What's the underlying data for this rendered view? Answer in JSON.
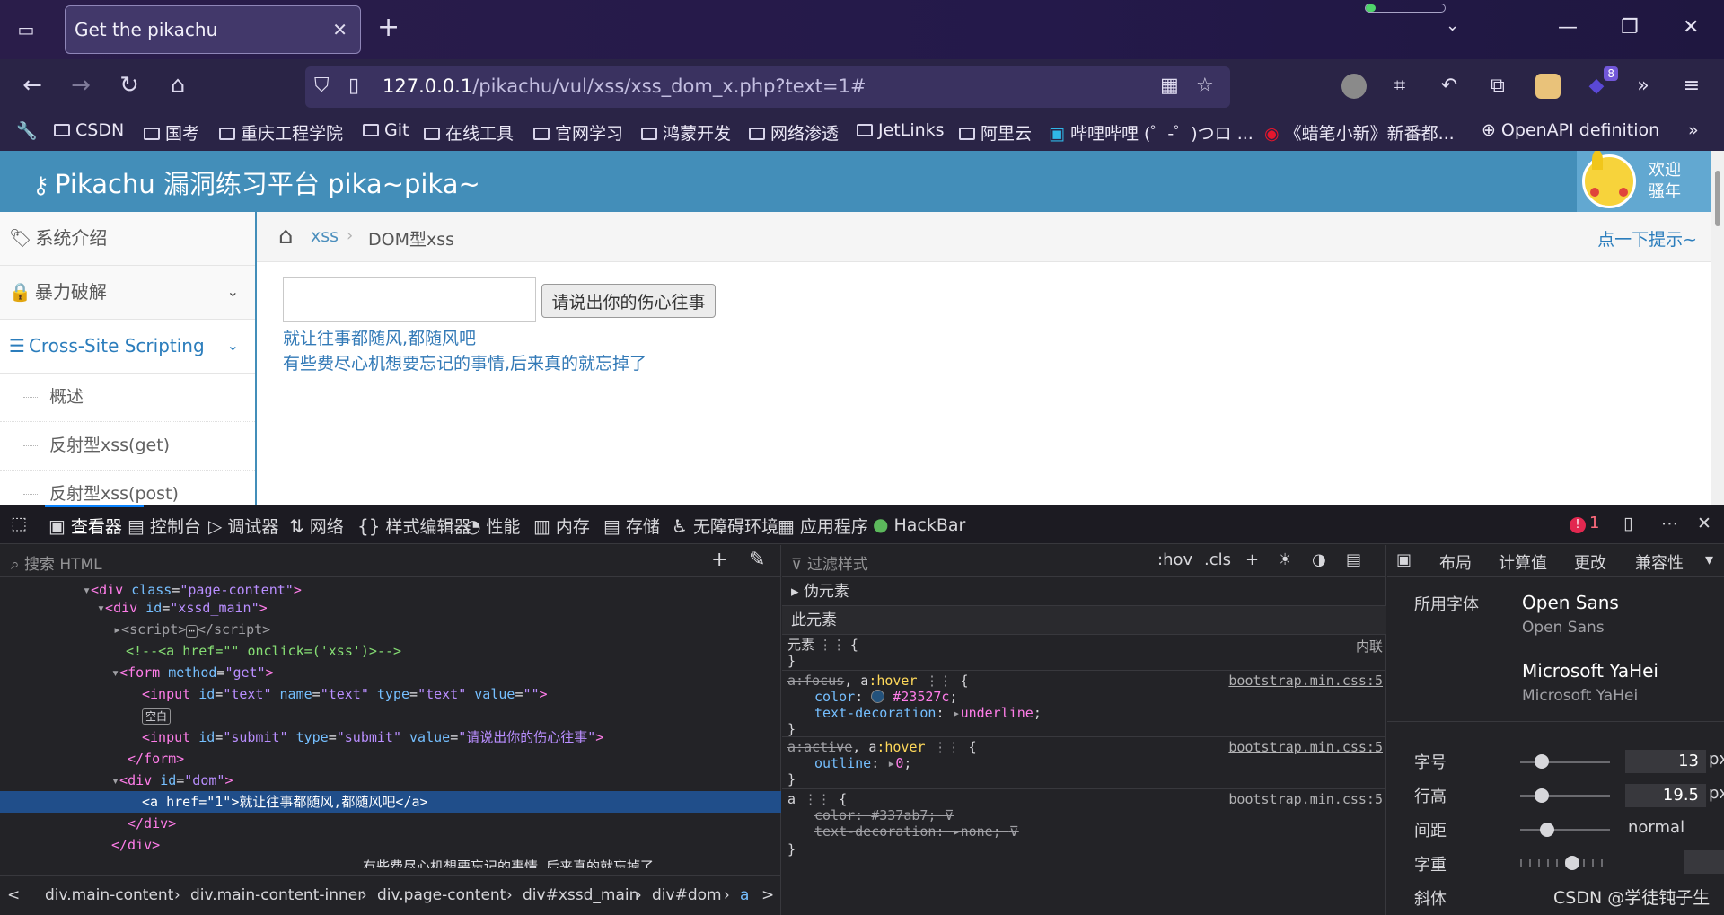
{
  "browser": {
    "tab_title": "Get the pikachu",
    "url_host": "127.0.0.1",
    "url_path": "/pikachu/vul/xss/xss_dom_x.php?text=1#",
    "ext_badge_count": "8",
    "load_progress": 0.12
  },
  "bookmarks": [
    "CSDN",
    "国考",
    "重庆工程学院",
    "Git",
    "在线工具",
    "官网学习",
    "鸿蒙开发",
    "网络渗透",
    "JetLinks",
    "阿里云",
    "哔哩哔哩 (゜-゜)つロ ...",
    "《蜡笔小新》新番都...",
    "OpenAPI definition"
  ],
  "site": {
    "title": "Pikachu 漏洞练习平台 pika~pika~",
    "welcome": "欢迎",
    "username": "骚年"
  },
  "sidebar": {
    "items": [
      "系统介绍",
      "暴力破解",
      "Cross-Site Scripting"
    ],
    "subitems": [
      "概述",
      "反射型xss(get)",
      "反射型xss(post)"
    ]
  },
  "breadcrumb": {
    "section": "xss",
    "current": "DOM型xss",
    "hint": "点一下提示~"
  },
  "main": {
    "input_value": "",
    "submit_label": "请说出你的伤心往事",
    "dom_link": "就让往事都随风,都随风吧",
    "message": "有些费尽心机想要忘记的事情,后来真的就忘掉了"
  },
  "devtools": {
    "tabs": [
      "查看器",
      "控制台",
      "调试器",
      "网络",
      "样式编辑器",
      "性能",
      "内存",
      "存储",
      "无障碍环境",
      "应用程序",
      "HackBar"
    ],
    "error_count": "1",
    "search_placeholder": "搜索 HTML",
    "filter_placeholder": "过滤样式",
    "filter_actions": [
      ":hov",
      ".cls"
    ],
    "breadcrumbs": [
      "div.main-content",
      "div.main-content-inner",
      "div.page-content",
      "div#xssd_main",
      "div#dom",
      "a"
    ],
    "empty_badge": "空白",
    "tree": {
      "l1_tag": "div",
      "l1_attr": "class",
      "l1_val": "\"page-content\"",
      "l2_tag": "div",
      "l2_attr": "id",
      "l2_val": "\"xssd_main\"",
      "l3_tag": "script",
      "l4_comment": "<!--<a href=\"\" onclick=('xss')>-->",
      "l5_tag": "form",
      "l5_attr": "method",
      "l5_val": "\"get\"",
      "l6_tag": "input",
      "l6_a1": "id",
      "l6_v1": "\"text\"",
      "l6_a2": "name",
      "l6_v2": "\"text\"",
      "l6_a3": "type",
      "l6_v3": "\"text\"",
      "l6_a4": "value",
      "l6_v4": "\"\"",
      "l8_tag": "input",
      "l8_a1": "id",
      "l8_v1": "\"submit\"",
      "l8_a2": "type",
      "l8_v2": "\"submit\"",
      "l8_a3": "value",
      "l8_v3": "\"请说出你的伤心往事\"",
      "l9_close": "</form>",
      "l10_tag": "div",
      "l10_attr": "id",
      "l10_val": "\"dom\"",
      "l11_tag": "a",
      "l11_attr": "href",
      "l11_val": "\"1\"",
      "l11_text": "就让往事都随风,都随风吧",
      "l12_close": "</div>",
      "l13_close": "</div>",
      "l14_overflow": "有些费尽心机想要忘记的事情,后来真的就忘掉了"
    },
    "styles": {
      "pseudo": "伪元素",
      "this_element": "此元素",
      "element_selector": "元素",
      "inline": "内联",
      "rule1_sel_a": "a:focus",
      "rule1_sel_b": "a:hover",
      "rule1_src": "bootstrap.min.css:5",
      "rule1_p1": "color",
      "rule1_v1": "#23527c",
      "rule1_p2": "text-decoration",
      "rule1_v2": "underline",
      "rule2_sel_a": "a:active",
      "rule2_sel_b": "a:hover",
      "rule2_src": "bootstrap.min.css:5",
      "rule2_p1": "outline",
      "rule2_v1": "0",
      "rule3_sel": "a",
      "rule3_src": "bootstrap.min.css:5",
      "rule3_p1": "color",
      "rule3_v1": "#337ab7",
      "rule3_p2": "text-decoration",
      "rule3_v2": "none"
    },
    "right_tabs": [
      "布局",
      "计算值",
      "更改",
      "兼容性"
    ],
    "fonts": {
      "label": "所用字体",
      "font1": "Open Sans",
      "font1_sub": "Open Sans",
      "font2": "Microsoft YaHei",
      "font2_sub": "Microsoft YaHei",
      "size_label": "字号",
      "size_value": "13",
      "line_label": "行高",
      "line_value": "19.5",
      "spacing_label": "间距",
      "spacing_value": "normal",
      "weight_label": "字重",
      "italic_label": "斜体",
      "unit": "px"
    }
  },
  "watermark": "CSDN @学徒钝子生"
}
